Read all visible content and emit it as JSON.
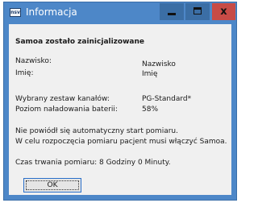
{
  "window": {
    "icon_text": "nsv",
    "title": "Informacja"
  },
  "titlebar_buttons": {
    "minimize": "minimize",
    "maximize": "maximize",
    "close_glyph": "x"
  },
  "dialog": {
    "heading": "Samoa zostało zainicjalizowane",
    "surname_label": "Nazwisko:",
    "surname_value": "Nazwisko",
    "firstname_label": "Imię:",
    "firstname_value": "Imię",
    "channel_set_label": "Wybrany zestaw kanałów:",
    "channel_set_value": "PG-Standard*",
    "battery_label": "Poziom naładowania baterii:",
    "battery_value": "58%",
    "message_line1": "Nie powiódł się automatyczny start pomiaru.",
    "message_line2": "W celu rozpoczęcia pomiaru pacjent musi włączyć Samoa.",
    "duration": "Czas trwania pomiaru: 8 Godziny 0 Minuty.",
    "ok_label": "OK"
  },
  "colors": {
    "titlebar": "#4d87c8",
    "close_button": "#c74b46",
    "client_background": "#f0f0f0"
  }
}
